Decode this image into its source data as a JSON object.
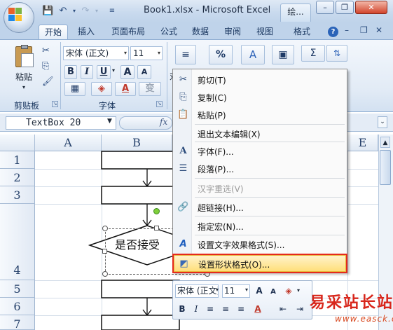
{
  "window": {
    "title": "Book1.xlsx - Microsoft Excel",
    "context_tab": "绘...",
    "minimize": "–",
    "restore": "❐",
    "close": "✕"
  },
  "ribbon": {
    "tabs": [
      "开始",
      "插入",
      "页面布局",
      "公式",
      "数据",
      "审阅",
      "视图",
      "格式"
    ],
    "active_tab": "开始",
    "clipboard": {
      "paste_label": "粘贴",
      "group_label": "剪贴板"
    },
    "font": {
      "name": "宋体 (正文)",
      "size": "11",
      "group_label": "字体",
      "bold": "B",
      "italic": "I",
      "underline": "U",
      "grow": "A",
      "shrink": "A",
      "phonetic": "变"
    },
    "percent": "%",
    "sigma": "Σ",
    "partial_label": "对"
  },
  "formula_bar": {
    "name_box": "TextBox 20",
    "fx": "fx"
  },
  "grid": {
    "columns": [
      "A",
      "B",
      "E"
    ],
    "rows": [
      "1",
      "2",
      "3",
      "4",
      "5",
      "6",
      "7"
    ]
  },
  "shape": {
    "decision_text": "是否接受"
  },
  "context_menu": {
    "items": [
      {
        "label": "剪切(T)",
        "icon": "scissors-icon",
        "enabled": true
      },
      {
        "label": "复制(C)",
        "icon": "copy-icon",
        "enabled": true
      },
      {
        "label": "粘贴(P)",
        "icon": "paste-icon",
        "enabled": true
      },
      {
        "label": "退出文本编辑(X)",
        "icon": "",
        "enabled": true
      },
      {
        "label": "字体(F)...",
        "icon": "font-icon",
        "enabled": true
      },
      {
        "label": "段落(P)...",
        "icon": "paragraph-icon",
        "enabled": true
      },
      {
        "label": "汉字重选(V)",
        "icon": "",
        "enabled": false
      },
      {
        "label": "超链接(H)...",
        "icon": "hyperlink-icon",
        "enabled": true
      },
      {
        "label": "指定宏(N)...",
        "icon": "",
        "enabled": true
      },
      {
        "label": "设置文字效果格式(S)...",
        "icon": "text-effect-icon",
        "enabled": true
      },
      {
        "label": "设置形状格式(O)...",
        "icon": "shape-format-icon",
        "enabled": true,
        "highlighted": true
      }
    ]
  },
  "mini_toolbar": {
    "font": "宋体 (正文)",
    "size": "11",
    "bold": "B",
    "italic": "I"
  },
  "watermark": {
    "text": "易采站长站",
    "url": "www.easck.com"
  },
  "colors": {
    "highlight_outline": "#e52a1c",
    "menu_highlight": "#ffdf7a",
    "ribbon_bg": "#e2ebf6"
  }
}
